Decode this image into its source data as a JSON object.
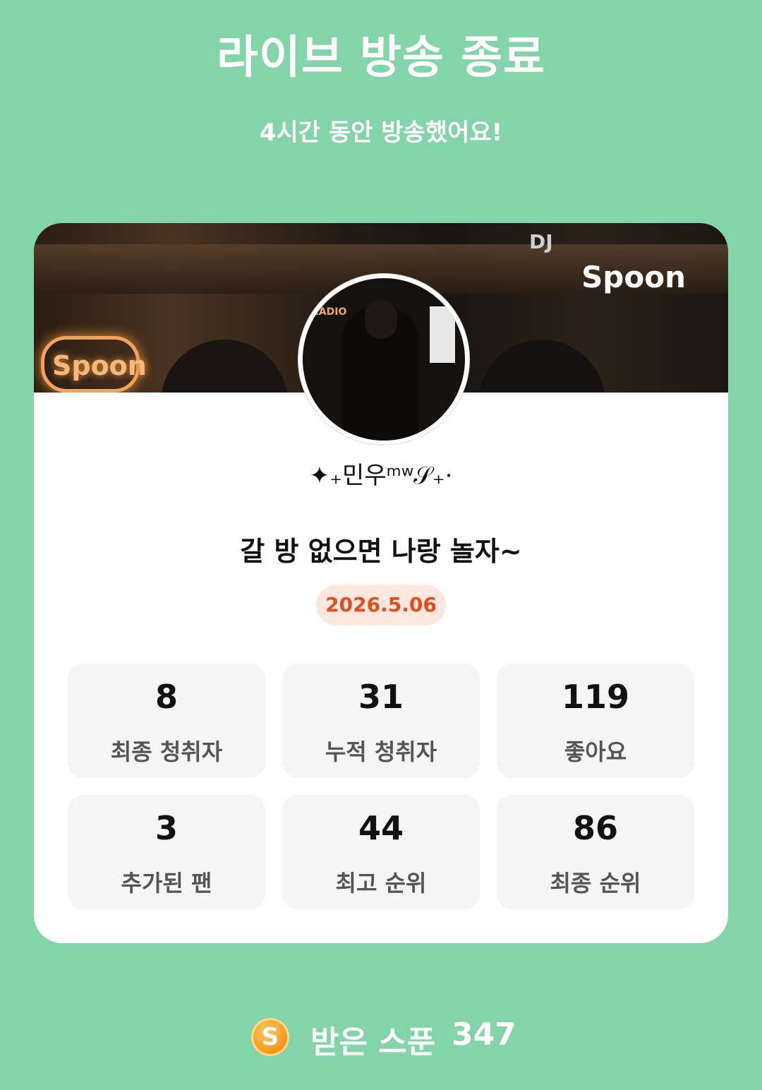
{
  "header": {
    "title": "라이브 방송 종료",
    "subtitle": "4시간 동안 방송했어요!"
  },
  "card": {
    "banner_brand": "Spoon",
    "banner_sign": "Spoon",
    "banner_dj": "DJ",
    "avatar_radio": "RADIO",
    "nickname": "✦₊민우ᵐʷ𝒮₊·",
    "live_title": "갈 방 없으면 나랑 놀자~",
    "date": "2026.5.06"
  },
  "stats": [
    {
      "value": "8",
      "label": "최종 청취자"
    },
    {
      "value": "31",
      "label": "누적 청취자"
    },
    {
      "value": "119",
      "label": "좋아요"
    },
    {
      "value": "3",
      "label": "추가된 팬"
    },
    {
      "value": "44",
      "label": "최고 순위"
    },
    {
      "value": "86",
      "label": "최종 순위"
    }
  ],
  "footer": {
    "coin_icon_letter": "S",
    "label": "받은 스푼",
    "count": "347"
  },
  "colors": {
    "background": "#83d4a8",
    "date_text": "#e34d1f",
    "date_bg": "#fde7df",
    "coin": "#f59a1c"
  }
}
